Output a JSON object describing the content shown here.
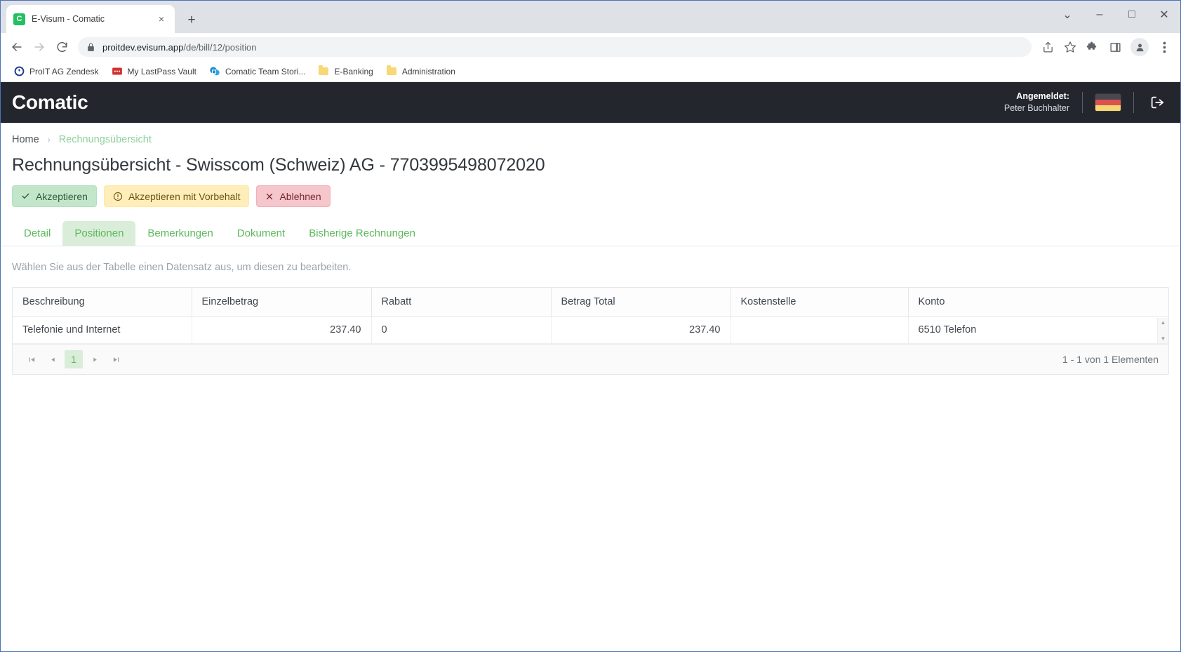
{
  "browser": {
    "tab": {
      "title": "E-Visum - Comatic",
      "favicon_letter": "C",
      "close_label": "×"
    },
    "new_tab_label": "+",
    "window_controls": {
      "expand": "⌄",
      "minimize": "–",
      "maximize": "□",
      "close": "✕"
    },
    "toolbar": {
      "back": "←",
      "forward": "→",
      "reload": "↻",
      "url_host": "proitdev.evisum.app",
      "url_path": "/de/bill/12/position",
      "share_icon": "share-icon",
      "bookmark_icon": "star-icon",
      "extensions_icon": "puzzle-icon",
      "sidepanel_icon": "side-panel-icon",
      "profile_icon": "profile-icon",
      "menu_icon": "kebab-menu-icon"
    },
    "bookmarks": [
      {
        "label": "ProIT AG Zendesk",
        "icon": "zendesk-icon"
      },
      {
        "label": "My LastPass Vault",
        "icon": "lastpass-icon"
      },
      {
        "label": "Comatic Team Stori...",
        "icon": "sharepoint-icon"
      },
      {
        "label": "E-Banking",
        "icon": "folder-icon"
      },
      {
        "label": "Administration",
        "icon": "folder-icon"
      }
    ]
  },
  "app": {
    "brand": "Comatic",
    "user": {
      "label": "Angemeldet:",
      "name": "Peter Buchhalter"
    },
    "flag": {
      "name": "german-flag",
      "colors": [
        "#4b4650",
        "#d9534f",
        "#f7d774"
      ]
    },
    "logout_icon": "logout-icon",
    "breadcrumb": {
      "home": "Home",
      "separator": "›",
      "current": "Rechnungsübersicht"
    },
    "page_title": "Rechnungsübersicht - Swisscom (Schweiz) AG - 7703995498072020",
    "actions": [
      {
        "label": "Akzeptieren",
        "icon": "check-icon",
        "glyph": "✓",
        "style": "accept"
      },
      {
        "label": "Akzeptieren mit Vorbehalt",
        "icon": "exclamation-circle-icon",
        "glyph": "ⓘ",
        "style": "reserve"
      },
      {
        "label": "Ablehnen",
        "icon": "cross-icon",
        "glyph": "✕",
        "style": "reject"
      }
    ],
    "tabs": [
      {
        "label": "Detail",
        "active": false
      },
      {
        "label": "Positionen",
        "active": true
      },
      {
        "label": "Bemerkungen",
        "active": false
      },
      {
        "label": "Dokument",
        "active": false
      },
      {
        "label": "Bisherige Rechnungen",
        "active": false
      }
    ],
    "hint": "Wählen Sie aus der Tabelle einen Datensatz aus, um diesen zu bearbeiten.",
    "table": {
      "columns": [
        "Beschreibung",
        "Einzelbetrag",
        "Rabatt",
        "Betrag Total",
        "Kostenstelle",
        "Konto"
      ],
      "rows": [
        {
          "beschreibung": "Telefonie und Internet",
          "einzelbetrag": "237.40",
          "rabatt": "0",
          "betrag_total": "237.40",
          "kostenstelle": "",
          "konto": "6510 Telefon"
        }
      ]
    },
    "pager": {
      "first": "⏮",
      "prev": "◀",
      "page": "1",
      "next": "▶",
      "last": "⏭",
      "info": "1 - 1 von 1 Elementen"
    },
    "colors": {
      "header_bg": "#23262d",
      "accent_green": "#5cb85c",
      "accent_green_bg": "#d9edd9"
    }
  }
}
